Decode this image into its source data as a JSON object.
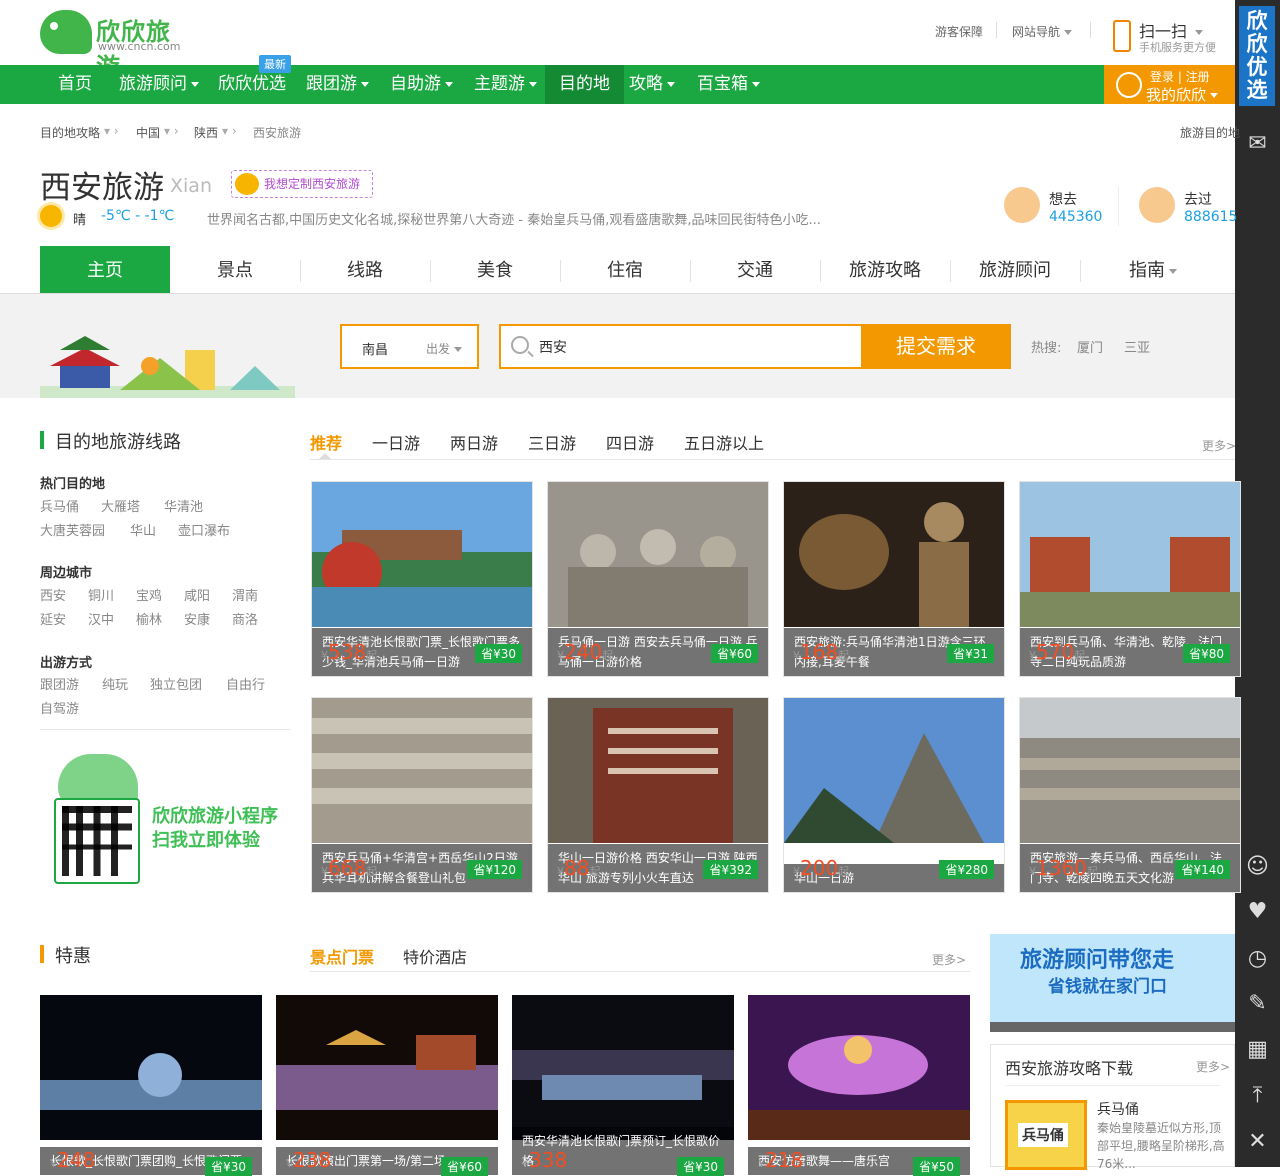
{
  "header": {
    "logo_text": "欣欣旅游",
    "logo_url": "www.cncn.com",
    "guarantee": "游客保障",
    "site_nav": "网站导航",
    "scan_title": "扫一扫",
    "scan_sub": "手机服务更方便",
    "login": "登录 | 注册",
    "my_account": "我的欣欣"
  },
  "nav": {
    "items": [
      "首页",
      "旅游顾问",
      "欣欣优选",
      "跟团游",
      "自助游",
      "主题游",
      "目的地",
      "攻略",
      "百宝箱"
    ],
    "new_badge": "最新"
  },
  "rightbar": {
    "ad_text": "欣欣优选"
  },
  "breadcrumb": [
    "目的地攻略",
    "中国",
    "陕西",
    "西安旅游"
  ],
  "breadcrumb_right": "旅游目的地",
  "city": {
    "name": "西安旅游",
    "pinyin": "Xian",
    "custom_button": "我想定制西安旅游",
    "weather": "晴",
    "temperature": "-5℃ - -1℃",
    "description": "世界闻名古都,中国历史文化名城,探秘世界第八大奇迹 - 秦始皇兵马俑,观看盛唐歌舞,品味回民街特色小吃...",
    "want_label": "想去",
    "want_count": "445360",
    "been_label": "去过",
    "been_count": "888615"
  },
  "tabs": [
    "主页",
    "景点",
    "线路",
    "美食",
    "住宿",
    "交通",
    "旅游攻略",
    "旅游顾问",
    "指南"
  ],
  "search": {
    "from_city": "南昌",
    "from_label": "出发",
    "query": "西安",
    "submit": "提交需求",
    "hot_label": "热搜:",
    "hot_items": [
      "厦门",
      "三亚"
    ]
  },
  "routes": {
    "title": "目的地旅游线路",
    "subtabs": [
      "推荐",
      "一日游",
      "两日游",
      "三日游",
      "四日游",
      "五日游以上"
    ],
    "more": "更多>",
    "hot_dest_title": "热门目的地",
    "hot_dest": [
      "兵马俑",
      "大雁塔",
      "华清池",
      "大唐芙蓉园",
      "华山",
      "壶口瀑布"
    ],
    "nearby_title": "周边城市",
    "nearby": [
      "西安",
      "铜川",
      "宝鸡",
      "咸阳",
      "渭南",
      "延安",
      "汉中",
      "榆林",
      "安康",
      "商洛"
    ],
    "mode_title": "出游方式",
    "modes": [
      "跟团游",
      "纯玩",
      "独立包团",
      "自由行",
      "自驾游"
    ],
    "cards": [
      {
        "caption": "西安华清池长恨歌门票_长恨歌门票多少钱_华清池兵马俑一日游",
        "price": "538",
        "save": "省¥30"
      },
      {
        "caption": "兵马俑一日游 西安去兵马俑一日游 兵马俑一日游价格",
        "price": "240",
        "save": "省¥60"
      },
      {
        "caption": "西安旅游:兵马俑华清池1日游含三环内接,耳麦午餐",
        "price": "168",
        "save": "省¥31"
      },
      {
        "caption": "西安到兵马俑、华清池、乾陵、法门寺二日纯玩品质游",
        "price": "570",
        "save": "省¥80"
      },
      {
        "caption": "西安兵马俑+华清宫+西岳华山2日游兵华耳机讲解含餐登山礼包",
        "price": "668",
        "save": "省¥120"
      },
      {
        "caption": "华山一日游价格 西安华山一日游 陕西华山 旅游专列小火车直达",
        "price": "88",
        "save": "省¥392"
      },
      {
        "caption": "华山一日游",
        "price": "200",
        "save": "省¥280"
      },
      {
        "caption": "西安旅游—秦兵马俑、西岳华山、法门寺、乾陵四晚五天文化游",
        "price": "1360",
        "save": "省¥140"
      }
    ],
    "price_unit": "起",
    "currency": "¥"
  },
  "mini_program": {
    "line1": "欣欣旅游小程序",
    "line2": "扫我立即体验"
  },
  "deals": {
    "title": "特惠",
    "subtabs": [
      "景点门票",
      "特价酒店"
    ],
    "more": "更多>",
    "cards": [
      {
        "caption": "长恨歌_长恨歌门票团购_长恨歌门票",
        "price": "248",
        "save": "省¥30"
      },
      {
        "caption": "长恨歌演出门票第一场/第二场",
        "price": "238",
        "save": "省¥60"
      },
      {
        "caption": "西安华清池长恨歌门票预订_长恨歌价格",
        "price": "338",
        "save": "省¥30"
      },
      {
        "caption": "西安仿唐歌舞——唐乐宫",
        "price": "218",
        "save": "省¥50"
      }
    ]
  },
  "side_ad": {
    "line1": "旅游顾问带您走",
    "line2": "省钱就在家门口"
  },
  "download": {
    "title": "西安旅游攻略下载",
    "more": "更多>",
    "book_label": "兵马俑",
    "item_name": "兵马俑",
    "item_desc": "秦始皇陵墓近似方形,顶部平坦,腰略呈阶梯形,高76米..."
  }
}
